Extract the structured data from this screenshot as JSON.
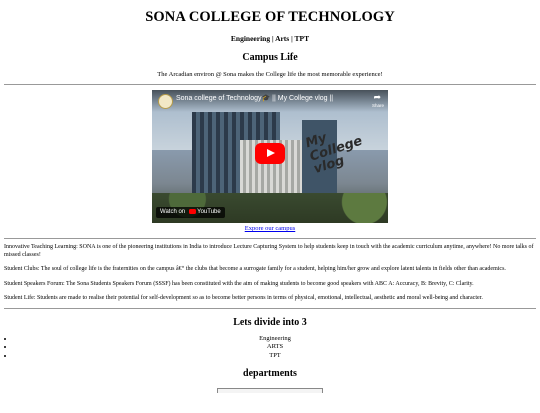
{
  "header": {
    "title": "SONA COLLEGE OF TECHNOLOGY",
    "nav": "Engineering | Arts | TPT"
  },
  "campus": {
    "heading": "Campus Life",
    "tagline": "The Arcadian environ @ Sona makes the College life the most memorable experience!"
  },
  "video": {
    "title": "Sona college of Technology🎓 || My College vlog ||",
    "overlay_text": "My College vlog",
    "share_label": "Share",
    "watch_on": "Watch on",
    "platform": "YouTube",
    "icons": [
      "channel-avatar",
      "share-icon",
      "play-icon",
      "youtube-logo-icon"
    ],
    "colors": {
      "play_button": "#ff0000"
    }
  },
  "explore_link": "Expore our campus",
  "paragraphs": [
    "Innovative Teaching Learning: SONA is one of the pioneering institutions in India to introduce Lecture Capturing System to help students keep in touch with the academic curriculum anytime, anywhere! No more talks of missed classes!",
    "Student Clubs: The soul of college life is the fraternities on the campus â€“ the clubs that become a surrogate family for a student, helping him/her grow and explore latent talents in fields other than academics.",
    "Student Speakers Forum: The Sona Students Speakers Forum (SSSF) has been constituted with the aim of making students to become good speakers with ABC A: Accuracy, B: Brevity, C: Clarity.",
    "Student Life: Students are made to realise their potential for self-development so as to become better persons in terms of physical, emotional, intellectual, aesthetic and moral well-being and character."
  ],
  "divide": {
    "heading": "Lets divide into 3",
    "items": [
      "Engineering",
      "ARTS",
      "TPT"
    ]
  },
  "departments": {
    "heading": "departments"
  }
}
